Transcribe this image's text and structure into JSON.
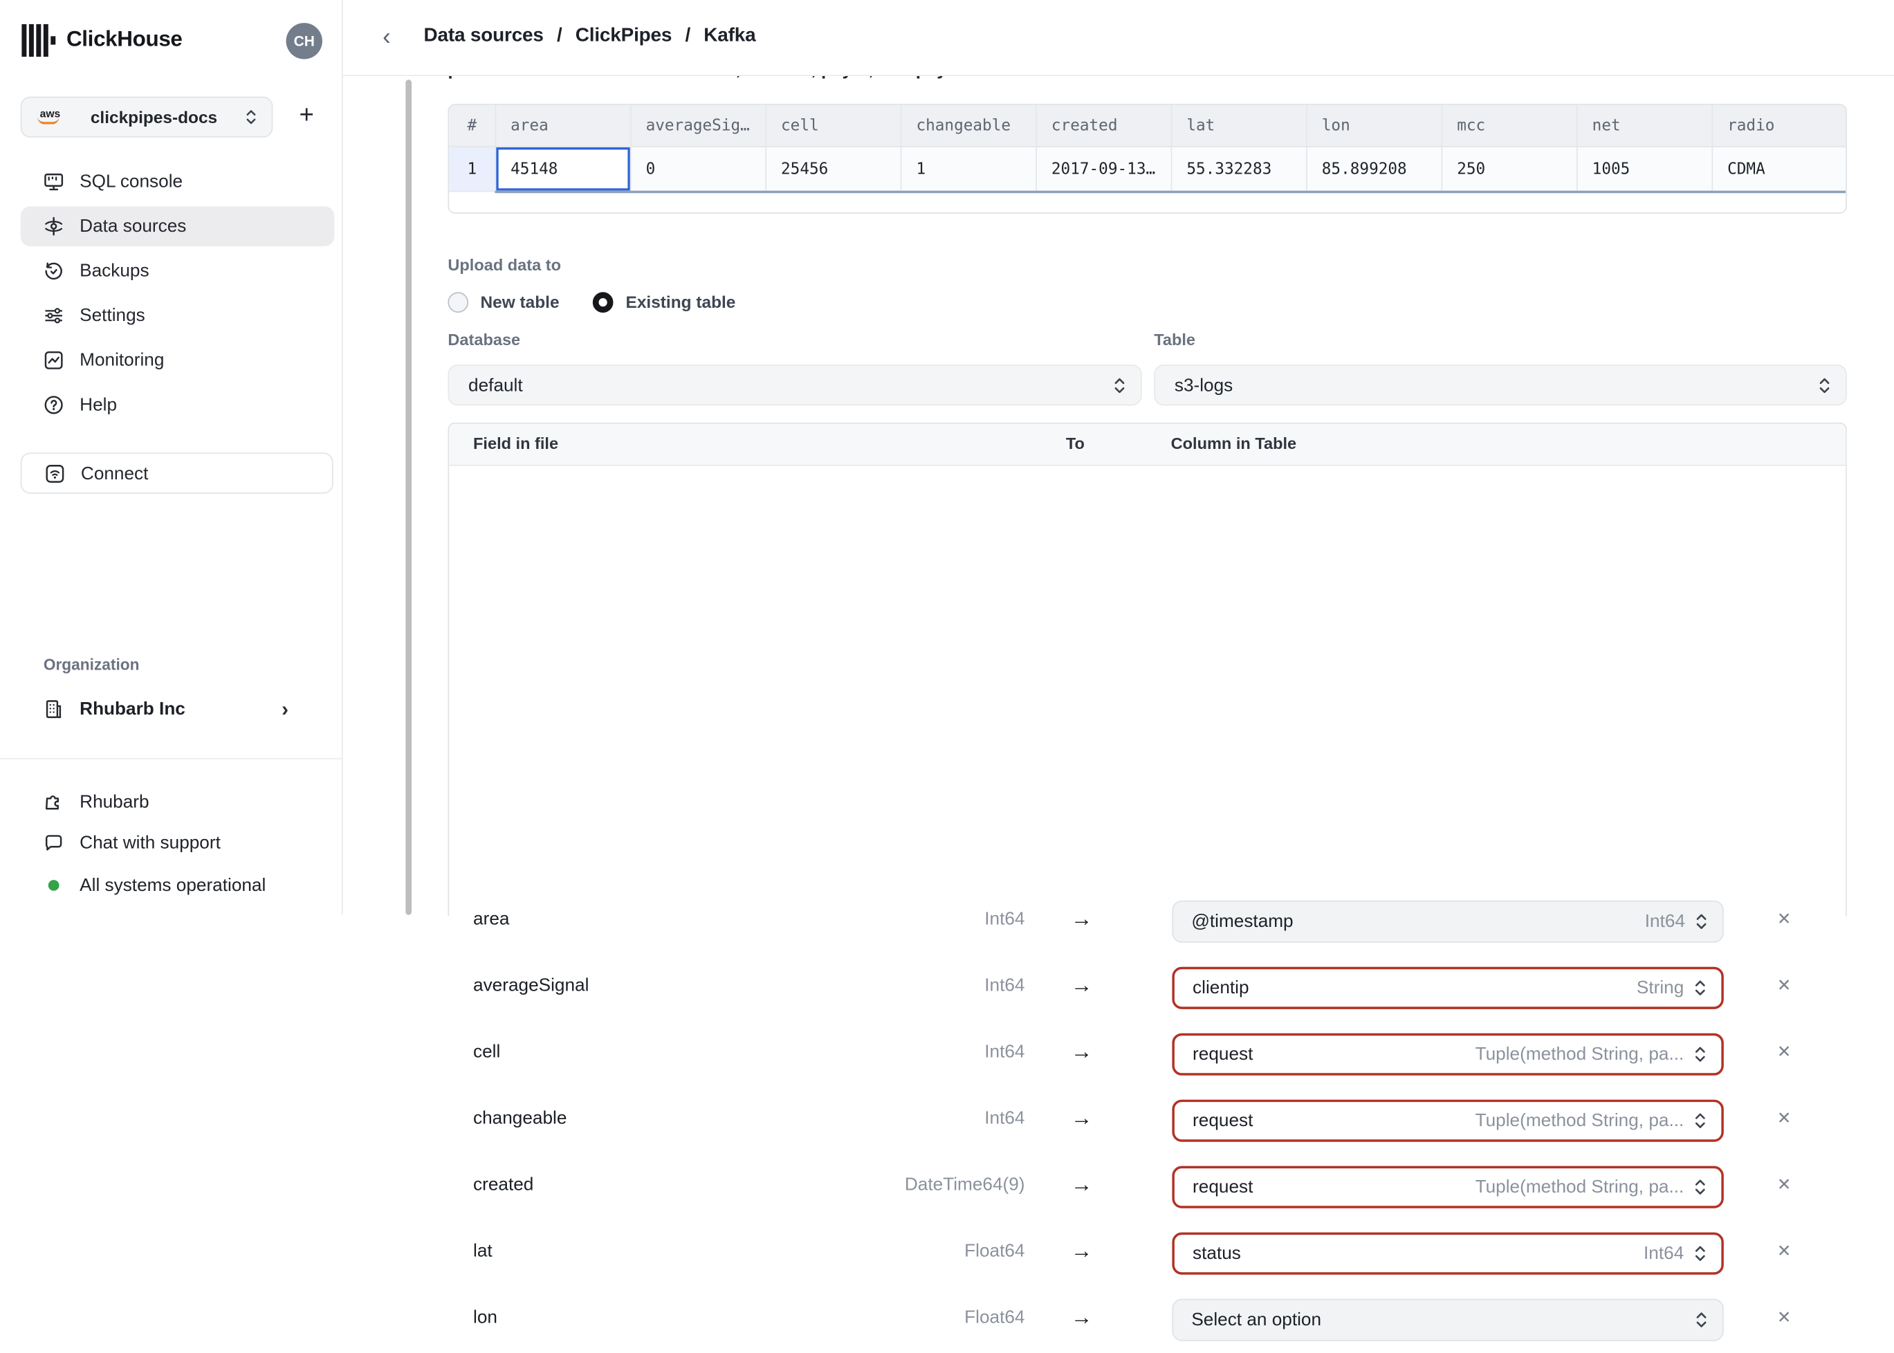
{
  "sidebar": {
    "logo_text": "ClickHouse",
    "avatar_initials": "CH",
    "service_selector": {
      "cloud": "aws",
      "label": "clickpipes-docs"
    },
    "add_service_glyph": "+",
    "nav": [
      {
        "label": "SQL console",
        "active": false
      },
      {
        "label": "Data sources",
        "active": true
      },
      {
        "label": "Backups",
        "active": false
      },
      {
        "label": "Settings",
        "active": false
      },
      {
        "label": "Monitoring",
        "active": false
      },
      {
        "label": "Help",
        "active": false
      }
    ],
    "connect_label": "Connect",
    "organization": {
      "section_label": "Organization",
      "name": "Rhubarb Inc",
      "chevron": "›"
    },
    "footer": {
      "app_label": "Rhubarb",
      "chat_label": "Chat with support",
      "status_label": "All systems operational"
    }
  },
  "header": {
    "back_glyph": "‹",
    "breadcrumb": [
      "Data sources",
      "ClickPipes",
      "Kafka"
    ],
    "separator": "/"
  },
  "main": {
    "clipped_text": "piece of information such as date, amount, payer, and payment method.",
    "preview_table": {
      "columns": [
        "#",
        "area",
        "averageSig…",
        "cell",
        "changeable",
        "created",
        "lat",
        "lon",
        "mcc",
        "net",
        "radio"
      ],
      "rows": [
        [
          "1",
          "45148",
          "0",
          "25456",
          "1",
          "2017-09-13…",
          "55.332283",
          "85.899208",
          "250",
          "1005",
          "CDMA"
        ]
      ],
      "selected_cell": {
        "row": 1,
        "column": "area",
        "value": "45148"
      }
    },
    "upload": {
      "label": "Upload data to",
      "options": [
        {
          "label": "New table",
          "selected": false
        },
        {
          "label": "Existing table",
          "selected": true
        }
      ]
    },
    "database": {
      "label": "Database",
      "value": "default"
    },
    "table": {
      "label": "Table",
      "value": "s3-logs"
    },
    "mapping": {
      "headers": {
        "field": "Field in file",
        "to": "To",
        "column": "Column in Table"
      },
      "arrow_glyph": "→",
      "remove_glyph": "✕",
      "rows": [
        {
          "field": "area",
          "type": "Int64",
          "column": "@timestamp",
          "column_type": "Int64",
          "state": "normal"
        },
        {
          "field": "averageSignal",
          "type": "Int64",
          "column": "clientip",
          "column_type": "String",
          "state": "error"
        },
        {
          "field": "cell",
          "type": "Int64",
          "column": "request",
          "column_type": "Tuple(method String, pa...",
          "state": "error"
        },
        {
          "field": "changeable",
          "type": "Int64",
          "column": "request",
          "column_type": "Tuple(method String, pa...",
          "state": "error"
        },
        {
          "field": "created",
          "type": "DateTime64(9)",
          "column": "request",
          "column_type": "Tuple(method String, pa...",
          "state": "error"
        },
        {
          "field": "lat",
          "type": "Float64",
          "column": "status",
          "column_type": "Int64",
          "state": "error"
        },
        {
          "field": "lon",
          "type": "Float64",
          "column": "Select an option",
          "column_type": "",
          "state": "normal"
        }
      ]
    }
  },
  "colors": {
    "error_border": "#b13325",
    "selected_cell_border": "#2e66d9",
    "status_ok": "#34a24a",
    "accent_orange": "#e8862d"
  }
}
